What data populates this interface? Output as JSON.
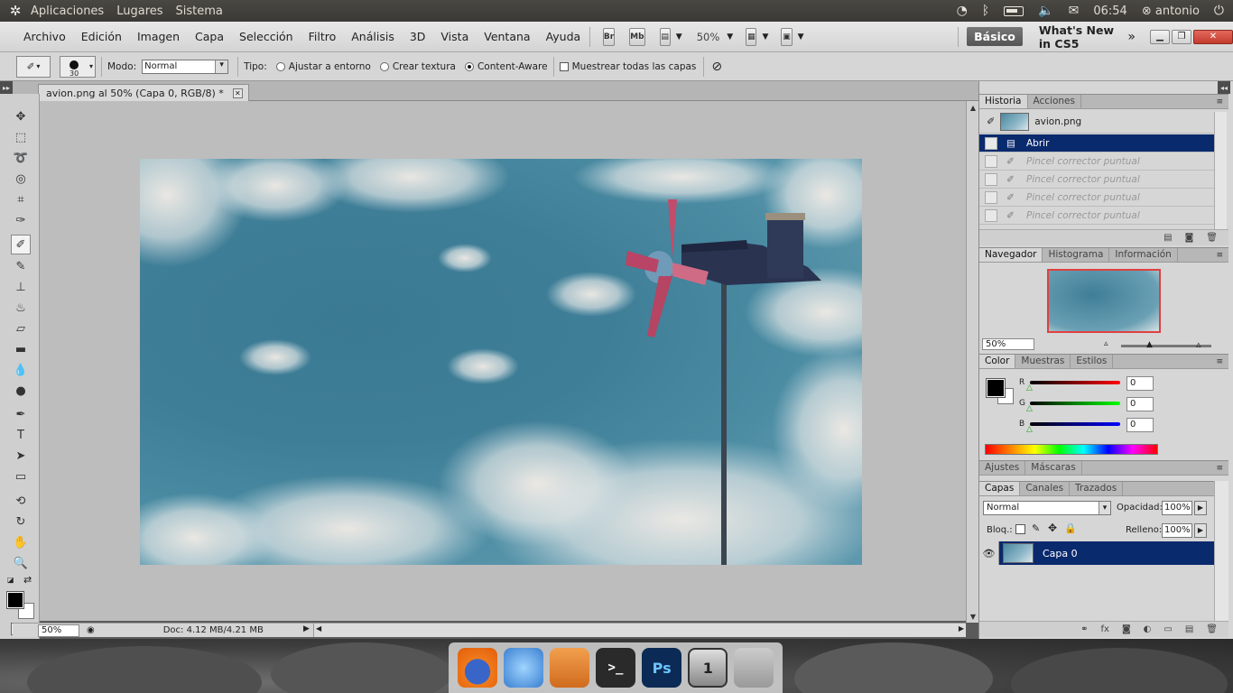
{
  "top_panel": {
    "menus": [
      "Aplicaciones",
      "Lugares",
      "Sistema"
    ],
    "clock": "06:54",
    "user": "antonio"
  },
  "appbar": {
    "menus": [
      "Archivo",
      "Edición",
      "Imagen",
      "Capa",
      "Selección",
      "Filtro",
      "Análisis",
      "3D",
      "Vista",
      "Ventana",
      "Ayuda"
    ],
    "bridge": "Br",
    "minibridge": "Mb",
    "zoom": "50%",
    "workspace": "Básico",
    "whats_new": "What's New in CS5"
  },
  "options": {
    "brush_size": "30",
    "mode_label": "Modo:",
    "mode_value": "Normal",
    "type_label": "Tipo:",
    "type_options": [
      "Ajustar a entorno",
      "Crear textura",
      "Content-Aware"
    ],
    "sample_all": "Muestrear todas las capas"
  },
  "document": {
    "tab_title": "avion.png al 50% (Capa 0, RGB/8) *"
  },
  "status": {
    "zoom": "50%",
    "doc_info": "Doc: 4.12 MB/4.21 MB"
  },
  "history_panel": {
    "tabs": [
      "Historia",
      "Acciones"
    ],
    "snapshot": "avion.png",
    "items": [
      "Abrir",
      "Pincel corrector puntual",
      "Pincel corrector puntual",
      "Pincel corrector puntual",
      "Pincel corrector puntual"
    ]
  },
  "navigator_panel": {
    "tabs": [
      "Navegador",
      "Histograma",
      "Información"
    ],
    "zoom": "50%"
  },
  "color_panel": {
    "tabs": [
      "Color",
      "Muestras",
      "Estilos"
    ],
    "r_label": "R",
    "g_label": "G",
    "b_label": "B",
    "r": "0",
    "g": "0",
    "b": "0"
  },
  "adjust_panel": {
    "tabs": [
      "Ajustes",
      "Máscaras"
    ]
  },
  "layers_panel": {
    "tabs": [
      "Capas",
      "Canales",
      "Trazados"
    ],
    "blend_mode": "Normal",
    "opacity_label": "Opacidad:",
    "opacity": "100%",
    "lock_label": "Bloq.:",
    "fill_label": "Relleno:",
    "fill": "100%",
    "layer_name": "Capa 0"
  },
  "dock": {
    "badge": "1"
  }
}
